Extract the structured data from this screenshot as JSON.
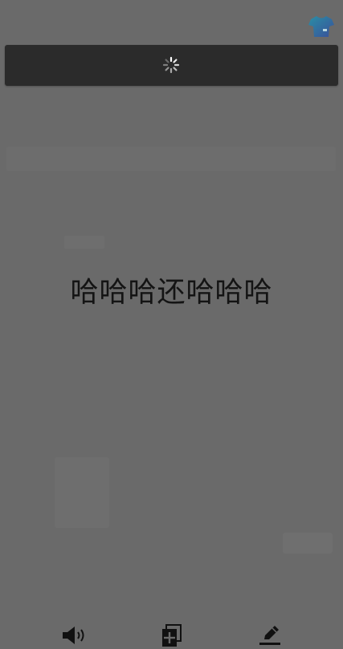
{
  "app": {
    "background_color": "#6a6a6a",
    "overlay_color": "#2b2b2b"
  },
  "header": {
    "theme_icon": "tshirt-icon"
  },
  "loading": {
    "icon": "spinner-icon"
  },
  "content": {
    "main_text": "哈哈哈还哈哈哈"
  },
  "toolbar": {
    "items": [
      {
        "icon": "speaker-icon"
      },
      {
        "icon": "add-page-icon"
      },
      {
        "icon": "edit-icon"
      }
    ]
  }
}
